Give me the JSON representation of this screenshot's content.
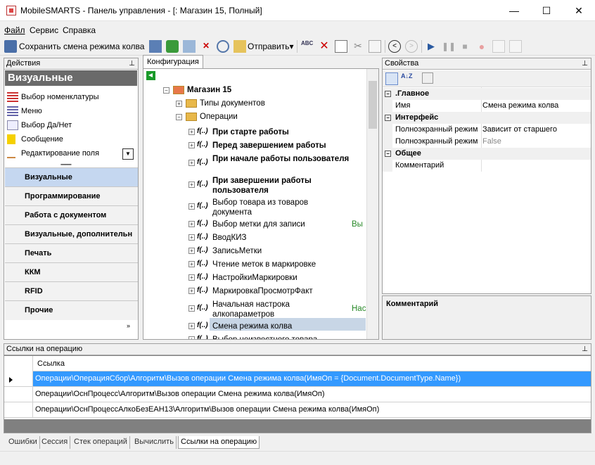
{
  "window": {
    "title": "MobileSMARTS - Панель управления - [: Магазин 15, Полный]",
    "minimize": "—",
    "maximize": "☐",
    "close": "✕"
  },
  "menu": [
    "Файл",
    "Сервис",
    "Справка"
  ],
  "toolbar": {
    "save_label": "Сохранить смена режима колва",
    "send_label": "Отправить▾"
  },
  "actions_panel": {
    "title": "Действия",
    "header": "Визуальные",
    "items": [
      "Выбор номенклатуры",
      "Меню",
      "Выбор Да/Нет",
      "Сообщение",
      "Редактирование поля"
    ],
    "categories": [
      "Визуальные",
      "Программирование",
      "Работа с документом",
      "Визуальные, дополнительн",
      "Печать",
      "ККМ",
      "RFID",
      "Прочие"
    ]
  },
  "config": {
    "tab": "Конфигурация",
    "root": "Магазин 15",
    "doc_types": "Типы документов",
    "operations": "Операции",
    "ops": [
      {
        "label": "При старте работы",
        "bold": true
      },
      {
        "label": "Перед завершением работы",
        "bold": true
      },
      {
        "label": "При начале работы пользователя",
        "bold": true
      },
      {
        "label": "При завершении работы пользователя",
        "bold": true
      },
      {
        "label": "Выбор товара из товаров документа",
        "bold": false
      },
      {
        "label": "Выбор метки для записи",
        "bold": false,
        "extra": "Вы"
      },
      {
        "label": "ВводКИЗ",
        "bold": false
      },
      {
        "label": "ЗаписьМетки",
        "bold": false
      },
      {
        "label": "Чтение меток в маркировке",
        "bold": false
      },
      {
        "label": "НастройкиМаркировки",
        "bold": false
      },
      {
        "label": "МаркировкаПросмотрФакт",
        "bold": false
      },
      {
        "label": "Начальная настрока алкопараметров",
        "bold": false,
        "extra": "Нас"
      },
      {
        "label": "Смена режима колва",
        "bold": false
      },
      {
        "label": "Выбор неизвестного товара",
        "bold": false
      }
    ]
  },
  "properties": {
    "title": "Свойства",
    "groups": [
      {
        "name": ".Главное",
        "rows": [
          {
            "name": "Имя",
            "value": "Смена режима колва",
            "dim": false
          }
        ]
      },
      {
        "name": "Интерфейс",
        "rows": [
          {
            "name": "Полноэкранный режим",
            "value": "Зависит от старшего",
            "dim": false
          },
          {
            "name": "Полноэкранный режим",
            "value": "False",
            "dim": true
          }
        ]
      },
      {
        "name": "Общее",
        "rows": [
          {
            "name": "Комментарий",
            "value": "",
            "dim": false
          }
        ]
      }
    ],
    "comment_title": "Комментарий"
  },
  "refs": {
    "title": "Ссылки на операцию",
    "column": "Ссылка",
    "rows": [
      "Операции\\ОперацияСбор\\Алгоритм\\Вызов операции Смена режима колва(ИмяОп = {Document.DocumentType.Name})",
      "Операции\\ОснПроцесс\\Алгоритм\\Вызов операции Смена режима колва(ИмяОп)",
      "Операции\\ОснПроцессАлкоБезЕАН13\\Алгоритм\\Вызов операции Смена режима колва(ИмяОп)"
    ]
  },
  "bottom_tabs": [
    "Ошибки",
    "Сессия",
    "Стек операций",
    "Вычислить",
    "Ссылки на операцию"
  ],
  "colors": {
    "selected_row": "#3399ff",
    "active_category": "#c5d7f0",
    "tree_selection": "#c8d6e6"
  },
  "icons": {
    "pin": "📌",
    "expand": "»"
  }
}
